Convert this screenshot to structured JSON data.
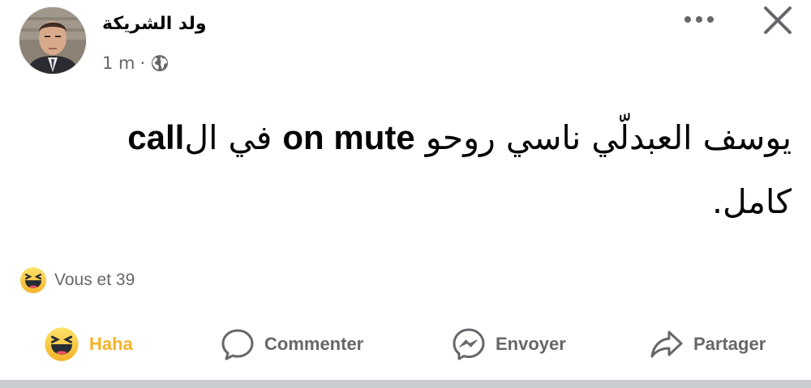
{
  "post": {
    "author": "ولد الشريكة",
    "time": "1 m",
    "separator": "·",
    "audience_icon": "globe-icon",
    "text_lines": [
      [
        "يوسف العبدلّي ناسي روحو ",
        "on mute",
        " في ال",
        "call"
      ],
      "كامل."
    ]
  },
  "reactions": {
    "icon": "haha-emoji-icon",
    "summary": "Vous et 39"
  },
  "actions": {
    "haha": "Haha",
    "comment": "Commenter",
    "send": "Envoyer",
    "share": "Partager"
  },
  "colors": {
    "haha_active": "#f7b125",
    "secondary_text": "#65676b",
    "divider": "#c9ccd1"
  }
}
